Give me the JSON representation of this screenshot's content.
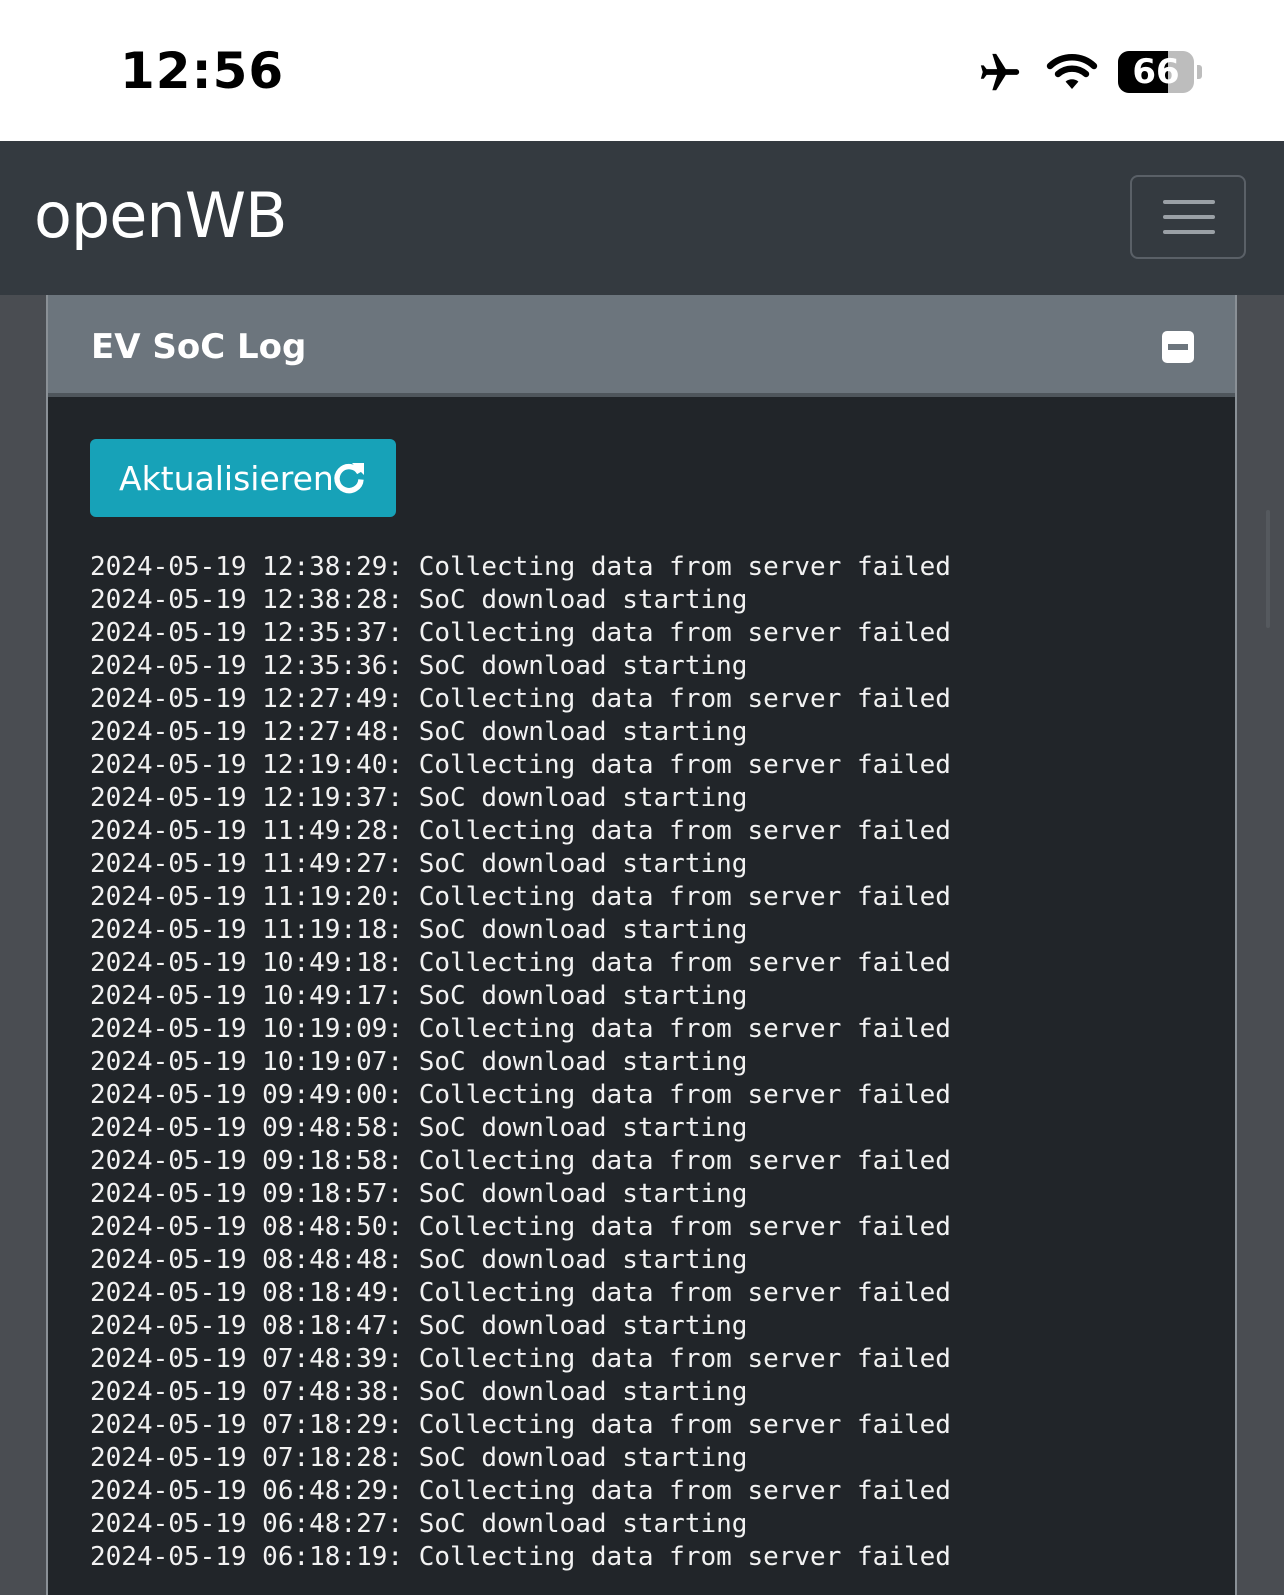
{
  "status_bar": {
    "time": "12:56",
    "battery_percent": 66,
    "battery_label": "66",
    "icons": [
      "airplane-icon",
      "wifi-icon",
      "battery-icon"
    ]
  },
  "navbar": {
    "brand": "openWB",
    "toggler_icon": "hamburger-menu-icon"
  },
  "card": {
    "title": "EV SoC Log",
    "collapse_icon": "minus-square-icon",
    "refresh_button": {
      "label": "Aktualisieren",
      "icon": "refresh-icon",
      "color": "#17a2b8"
    },
    "log_lines": [
      "2024-05-19 12:38:29: Collecting data from server failed",
      "2024-05-19 12:38:28: SoC download starting",
      "2024-05-19 12:35:37: Collecting data from server failed",
      "2024-05-19 12:35:36: SoC download starting",
      "2024-05-19 12:27:49: Collecting data from server failed",
      "2024-05-19 12:27:48: SoC download starting",
      "2024-05-19 12:19:40: Collecting data from server failed",
      "2024-05-19 12:19:37: SoC download starting",
      "2024-05-19 11:49:28: Collecting data from server failed",
      "2024-05-19 11:49:27: SoC download starting",
      "2024-05-19 11:19:20: Collecting data from server failed",
      "2024-05-19 11:19:18: SoC download starting",
      "2024-05-19 10:49:18: Collecting data from server failed",
      "2024-05-19 10:49:17: SoC download starting",
      "2024-05-19 10:19:09: Collecting data from server failed",
      "2024-05-19 10:19:07: SoC download starting",
      "2024-05-19 09:49:00: Collecting data from server failed",
      "2024-05-19 09:48:58: SoC download starting",
      "2024-05-19 09:18:58: Collecting data from server failed",
      "2024-05-19 09:18:57: SoC download starting",
      "2024-05-19 08:48:50: Collecting data from server failed",
      "2024-05-19 08:48:48: SoC download starting",
      "2024-05-19 08:18:49: Collecting data from server failed",
      "2024-05-19 08:18:47: SoC download starting",
      "2024-05-19 07:48:39: Collecting data from server failed",
      "2024-05-19 07:48:38: SoC download starting",
      "2024-05-19 07:18:29: Collecting data from server failed",
      "2024-05-19 07:18:28: SoC download starting",
      "2024-05-19 06:48:29: Collecting data from server failed",
      "2024-05-19 06:48:27: SoC download starting",
      "2024-05-19 06:18:19: Collecting data from server failed"
    ]
  }
}
